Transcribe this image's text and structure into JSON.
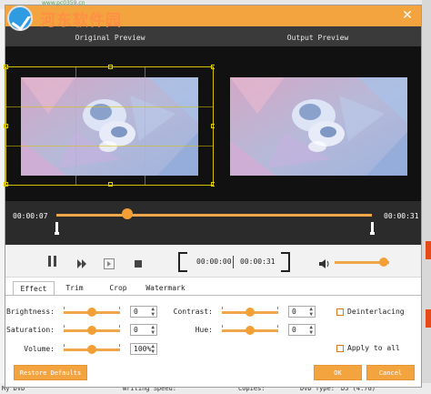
{
  "watermark": {
    "site_name": "河东软件园",
    "site_sub": "www.pc0359.cn"
  },
  "dialog": {
    "close_glyph": "✕"
  },
  "preview": {
    "original_label": "Original Preview",
    "output_label": "Output Preview"
  },
  "timeline": {
    "current_time": "00:00:07",
    "end_time": "00:00:31",
    "position_fraction": 0.226
  },
  "controls": {
    "start_time": "00:00:00",
    "end_time": "00:00:31",
    "volume_fraction": 0.9
  },
  "tabs": [
    {
      "label": "Effect"
    },
    {
      "label": "Trim"
    },
    {
      "label": "Crop"
    },
    {
      "label": "Watermark"
    }
  ],
  "effect": {
    "brightness": {
      "label": "Brightness:",
      "value": "0"
    },
    "saturation": {
      "label": "Saturation:",
      "value": "0"
    },
    "volume": {
      "label": "Volume:",
      "value": "100%"
    },
    "contrast": {
      "label": "Contrast:",
      "value": "0"
    },
    "hue": {
      "label": "Hue:",
      "value": "0"
    },
    "deinterlacing_label": "Deinterlacing",
    "apply_all_label": "Apply to all"
  },
  "buttons": {
    "restore": "Restore Defaults",
    "ok": "OK",
    "cancel": "Cancel"
  },
  "background": {
    "status_my_dvd": "My DVD",
    "status_writing_speed": "Writing Speed:",
    "status_copies": "Copies:",
    "status_dvd_type": "DVD Type:",
    "status_dvd_type_value": "D5 (4.7G)"
  },
  "colors": {
    "accent": "#f4a43f",
    "dark": "#111111"
  }
}
